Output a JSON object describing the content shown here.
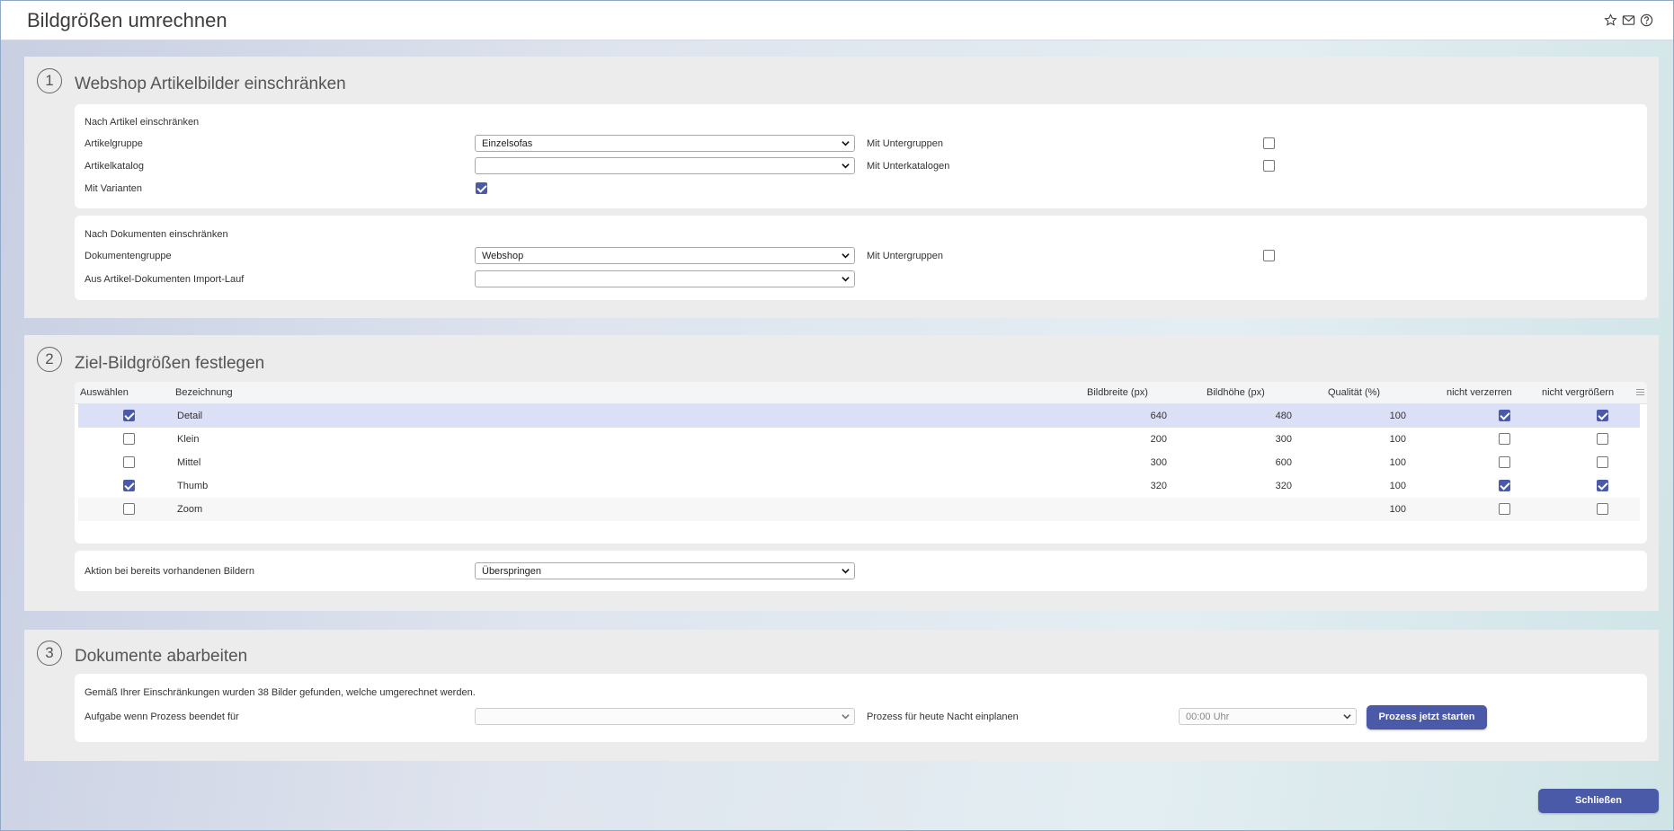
{
  "header": {
    "title": "Bildgrößen umrechnen"
  },
  "icons": {
    "favorite": "star-icon",
    "mail": "mail-icon",
    "help": "help-icon"
  },
  "colors": {
    "accent": "#4a5aa8",
    "selected_row": "#dbe0f6"
  },
  "section1": {
    "number": "1",
    "title": "Webshop Artikelbilder einschränken",
    "articles": {
      "heading": "Nach Artikel einschränken",
      "group_label": "Artikelgruppe",
      "group_value": "Einzelsofas",
      "subgroups_label": "Mit Untergruppen",
      "subgroups_checked": false,
      "catalog_label": "Artikelkatalog",
      "catalog_value": "",
      "subcatalogs_label": "Mit Unterkatalogen",
      "subcatalogs_checked": false,
      "variants_label": "Mit Varianten",
      "variants_checked": true
    },
    "documents": {
      "heading": "Nach Dokumenten einschränken",
      "group_label": "Dokumentengruppe",
      "group_value": "Webshop",
      "subgroups_label": "Mit Untergruppen",
      "subgroups_checked": false,
      "import_label": "Aus Artikel-Dokumenten Import-Lauf",
      "import_value": ""
    }
  },
  "section2": {
    "number": "2",
    "title": "Ziel-Bildgrößen festlegen",
    "columns": [
      "Auswählen",
      "Bezeichnung",
      "Bildbreite (px)",
      "Bildhöhe (px)",
      "Qualität (%)",
      "nicht verzerren",
      "nicht vergrößern"
    ],
    "rows": [
      {
        "selected": true,
        "name": "Detail",
        "width": "640",
        "height": "480",
        "quality": "100",
        "no_distort": true,
        "no_enlarge": true
      },
      {
        "selected": false,
        "name": "Klein",
        "width": "200",
        "height": "300",
        "quality": "100",
        "no_distort": false,
        "no_enlarge": false
      },
      {
        "selected": false,
        "name": "Mittel",
        "width": "300",
        "height": "600",
        "quality": "100",
        "no_distort": false,
        "no_enlarge": false
      },
      {
        "selected": true,
        "name": "Thumb",
        "width": "320",
        "height": "320",
        "quality": "100",
        "no_distort": true,
        "no_enlarge": true
      },
      {
        "selected": false,
        "name": "Zoom",
        "width": "",
        "height": "",
        "quality": "100",
        "no_distort": false,
        "no_enlarge": false
      }
    ],
    "action_label": "Aktion bei bereits vorhandenen Bildern",
    "action_value": "Überspringen"
  },
  "section3": {
    "number": "3",
    "title": "Dokumente abarbeiten",
    "info": "Gemäß Ihrer Einschränkungen wurden 38 Bilder gefunden, welche umgerechnet werden.",
    "task_label": "Aufgabe wenn Prozess beendet für",
    "task_value": "",
    "schedule_label": "Prozess für heute Nacht einplanen",
    "schedule_value": "00:00 Uhr",
    "start_button": "Prozess jetzt starten"
  },
  "footer": {
    "close_button": "Schließen"
  }
}
